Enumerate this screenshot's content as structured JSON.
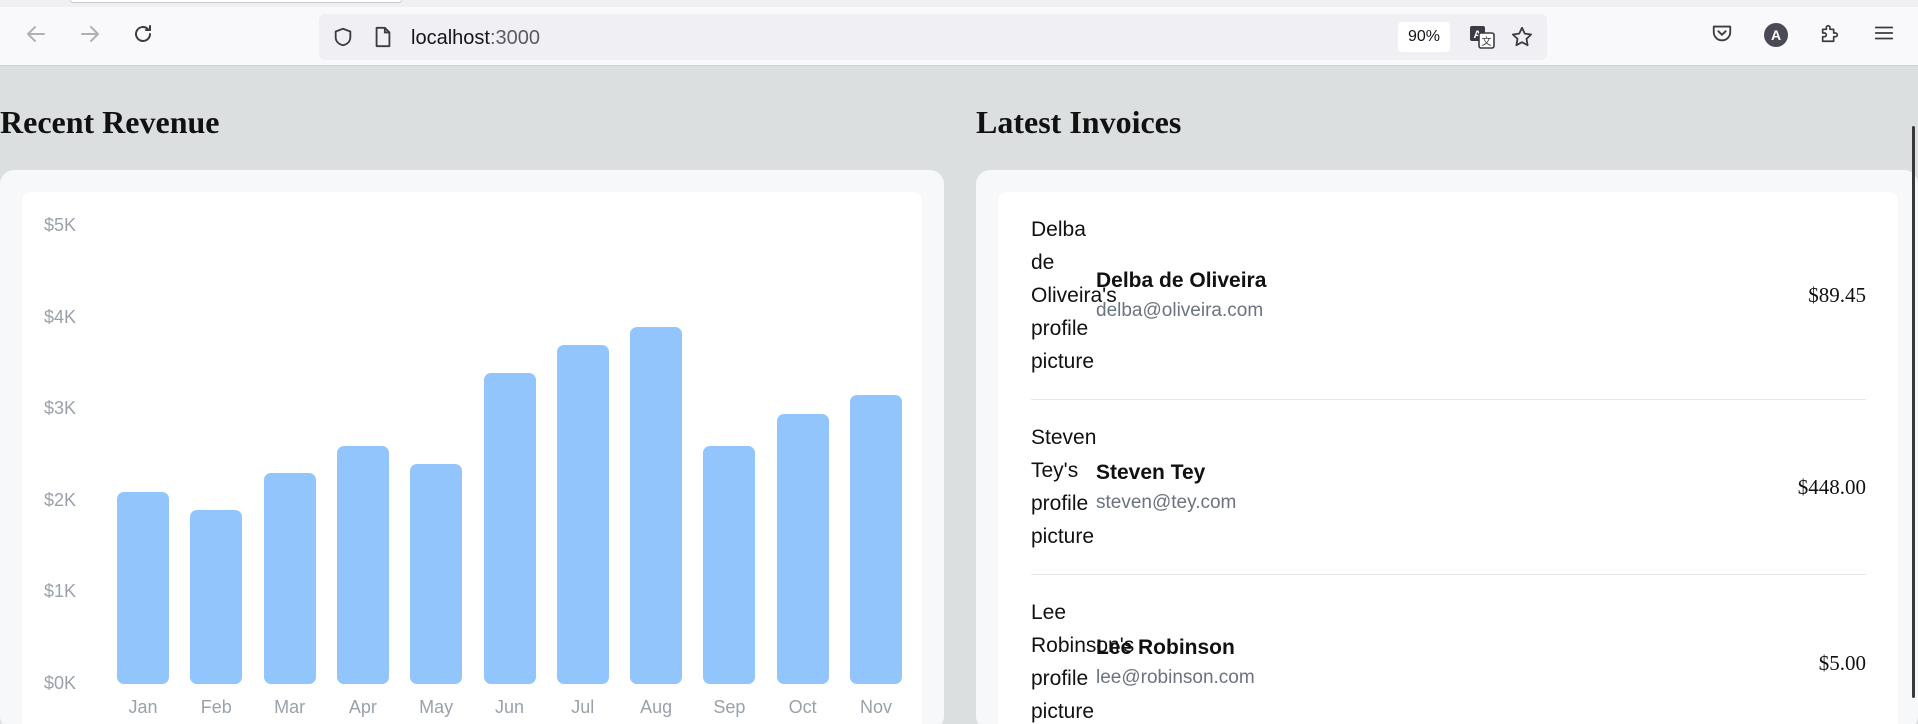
{
  "browser": {
    "url_host": "localhost",
    "url_port": ":3000",
    "zoom": "90%",
    "account_initial": "A",
    "icons": {
      "back": "back-arrow-icon",
      "forward": "forward-arrow-icon",
      "reload": "reload-icon",
      "shield": "tracking-protection-shield-icon",
      "page": "page-info-icon",
      "translate": "translate-icon",
      "bookmark": "bookmark-star-icon",
      "pocket": "pocket-icon",
      "account": "account-avatar-icon",
      "extensions": "extensions-puzzle-icon",
      "menu": "hamburger-menu-icon"
    }
  },
  "revenue": {
    "title": "Recent Revenue",
    "chart_data": {
      "type": "bar",
      "categories": [
        "Jan",
        "Feb",
        "Mar",
        "Apr",
        "May",
        "Jun",
        "Jul",
        "Aug",
        "Sep",
        "Oct",
        "Nov"
      ],
      "values": [
        2100,
        1900,
        2300,
        2600,
        2400,
        3400,
        3700,
        3900,
        2600,
        2950,
        3150
      ],
      "y_tick_labels": [
        "$5K",
        "$4K",
        "$3K",
        "$2K",
        "$1K",
        "$0K"
      ],
      "ylim": [
        0,
        5000
      ],
      "color": "#93c5fd",
      "grid": false
    }
  },
  "invoices": {
    "title": "Latest Invoices",
    "items": [
      {
        "alt_text": "Delba de Oliveira's profile picture",
        "name": "Delba de Oliveira",
        "email": "delba@oliveira.com",
        "amount": "$89.45"
      },
      {
        "alt_text": "Steven Tey's profile picture",
        "name": "Steven Tey",
        "email": "steven@tey.com",
        "amount": "$448.00"
      },
      {
        "alt_text": "Lee Robinson's profile picture",
        "name": "Lee Robinson",
        "email": "lee@robinson.com",
        "amount": "$5.00"
      }
    ]
  }
}
